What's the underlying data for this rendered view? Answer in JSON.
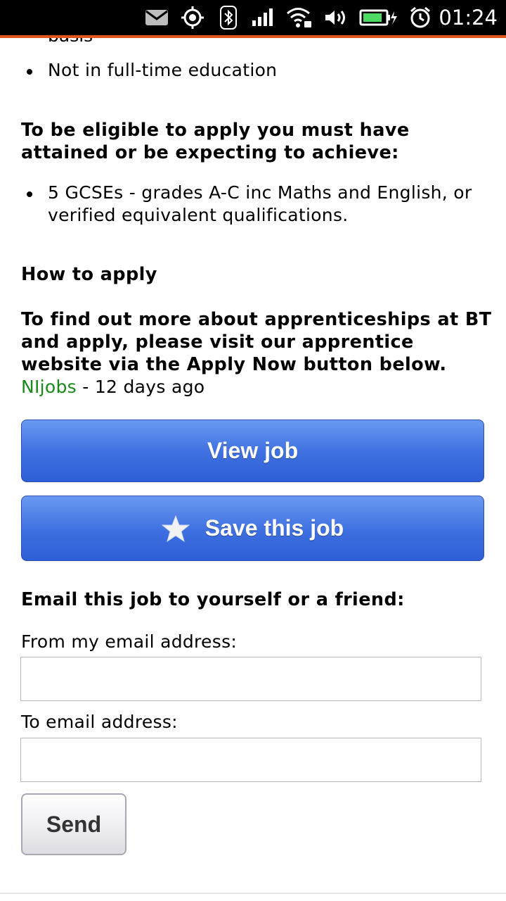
{
  "status_bar": {
    "time": "01:24",
    "icons": [
      "mail-icon",
      "location-icon",
      "bluetooth-icon",
      "signal-icon",
      "wifi-icon",
      "volume-icon",
      "battery-charging-icon",
      "alarm-icon"
    ],
    "accent_color": "#e2541c"
  },
  "content": {
    "cut_off_text": "basis",
    "list1": [
      "Not in full-time education"
    ],
    "eligibility_heading": "To be eligible to apply you must have attained or be expecting to achieve:",
    "list2": [
      "5 GCSEs - grades A-C inc Maths and English, or verified equivalent qualifications."
    ],
    "how_to_apply_heading": "How to apply",
    "apply_text": "To find out more about apprenticeships at BT and apply, please visit our apprentice website via the Apply Now button below.",
    "source": {
      "name": "NIjobs",
      "separator": " - ",
      "age": "12 days ago",
      "link_color": "#1a8a1a"
    }
  },
  "actions": {
    "view_job_label": "View job",
    "save_job_label": "Save this job"
  },
  "email_form": {
    "heading": "Email this job to yourself or a friend:",
    "from_label": "From my email address:",
    "from_value": "",
    "to_label": "To email address:",
    "to_value": "",
    "send_label": "Send"
  }
}
